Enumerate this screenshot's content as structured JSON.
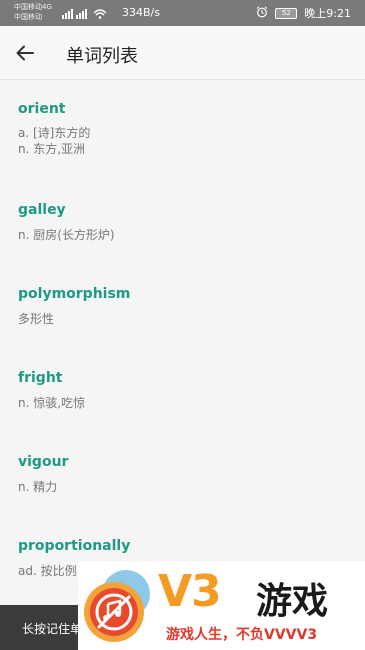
{
  "status_bar": {
    "carrier1": "中国移动4G",
    "carrier2": "中国移动",
    "signal_text": "4G",
    "speed": "334B/s",
    "battery": "52",
    "time": "晚上9:21"
  },
  "app_bar": {
    "title": "单词列表",
    "back_icon": "arrow-left-icon"
  },
  "words": [
    {
      "word": "orient",
      "defs": [
        "a. [诗]东方的",
        "n. 东方,亚洲"
      ]
    },
    {
      "word": "galley",
      "defs": [
        "n. 厨房(长方形炉)"
      ]
    },
    {
      "word": "polymorphism",
      "defs": [
        "多形性"
      ]
    },
    {
      "word": "fright",
      "defs": [
        "n. 惊骇,吃惊"
      ]
    },
    {
      "word": "vigour",
      "defs": [
        "n. 精力"
      ]
    },
    {
      "word": "proportionally",
      "defs": [
        "ad. 按比例"
      ]
    }
  ],
  "toast": {
    "text": "长按记住单"
  },
  "watermark": {
    "brand": "V3",
    "brand_cn": "游戏",
    "slogan": "游戏人生，不负VVVV3"
  },
  "colors": {
    "accent": "#1e9a84",
    "status_bar": "#7a7a7a",
    "toast": "#3b3b3b"
  }
}
